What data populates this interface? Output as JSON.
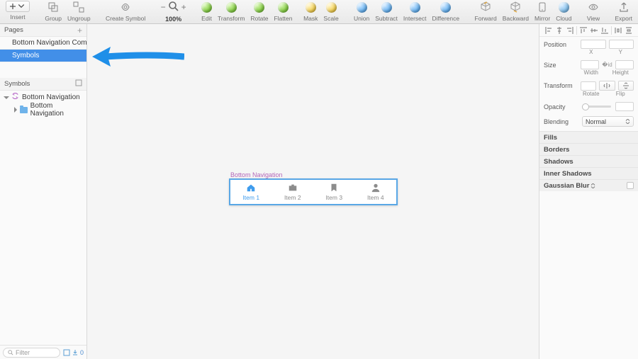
{
  "toolbar": {
    "insert": "Insert",
    "group": "Group",
    "ungroup": "Ungroup",
    "create_symbol": "Create Symbol",
    "zoom": "100%",
    "edit": "Edit",
    "transform": "Transform",
    "rotate": "Rotate",
    "flatten": "Flatten",
    "mask": "Mask",
    "scale": "Scale",
    "union": "Union",
    "subtract": "Subtract",
    "intersect": "Intersect",
    "difference": "Difference",
    "forward": "Forward",
    "backward": "Backward",
    "mirror": "Mirror",
    "cloud": "Cloud",
    "view": "View",
    "export": "Export"
  },
  "left": {
    "pages_header": "Pages",
    "page1": "Bottom Navigation Compo…",
    "page2": "Symbols",
    "symbols_header": "Symbols",
    "layer1": "Bottom Navigation",
    "layer2": "Bottom Navigation",
    "filter_placeholder": "Filter",
    "filter_count": "0"
  },
  "canvas": {
    "artboard_label": "Bottom Navigation",
    "items": [
      "Item 1",
      "Item 2",
      "Item 3",
      "Item 4"
    ]
  },
  "inspector": {
    "position": "Position",
    "pos_x": "X",
    "pos_y": "Y",
    "size": "Size",
    "size_w": "Width",
    "size_h": "Height",
    "transform": "Transform",
    "tr_rotate": "Rotate",
    "tr_flip": "Flip",
    "opacity": "Opacity",
    "blending": "Blending",
    "blend_val": "Normal",
    "fills": "Fills",
    "borders": "Borders",
    "shadows": "Shadows",
    "inner_shadows": "Inner Shadows",
    "gaussian": "Gaussian Blur"
  }
}
